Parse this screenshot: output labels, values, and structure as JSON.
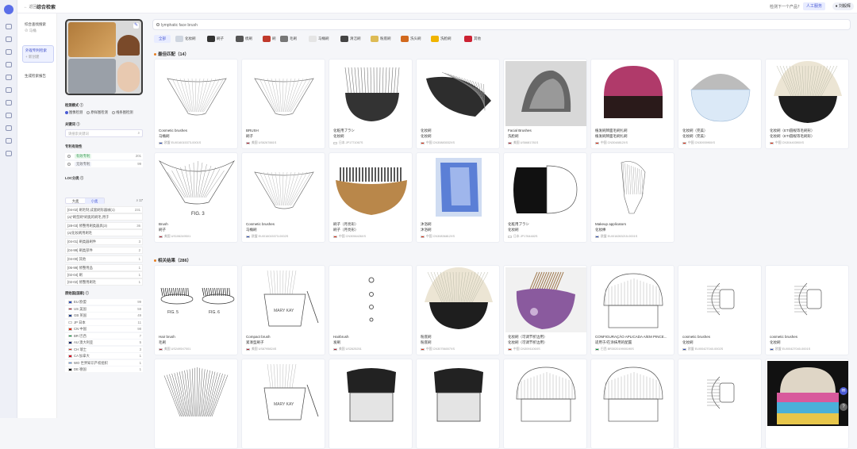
{
  "topbar": {
    "back": "← 返回",
    "title": "综合检索",
    "feedback": "检测下一个产品？",
    "human_btn": "人工服务",
    "user": "● 刘毅辉"
  },
  "sidebar": {
    "items": [
      {
        "label": "综合查找搜索",
        "sub": "⊘ 马桶"
      },
      {
        "label": "外观专利检索",
        "sub": "+ 新创建"
      },
      {
        "label": "生成检索报告",
        "sub": ""
      }
    ]
  },
  "filters": {
    "mode_label": "检测模式 ⓘ",
    "modes": [
      "图像检测",
      "原样图检测",
      "线条图检测"
    ],
    "keyword_label": "关键词 ⓘ",
    "keyword_placeholder": "请搜索关键词",
    "validity_label": "专利有效性",
    "validity": [
      {
        "label": "有效专利",
        "count": "201"
      },
      {
        "label": "无效专利",
        "count": "99"
      }
    ],
    "ldc_label": "LOC分类 ⓘ",
    "ldc_toggle": [
      "大类",
      "小类"
    ],
    "ldc_count": "17",
    "ldc_items": [
      {
        "label": "[04-02] 刷毛制,成套刷形器械(1)",
        "count": "231"
      },
      {
        "label": "(a)\"刷型刷\"刷类的刷毛,用于",
        "count": ""
      },
      {
        "label": "[28-03] 修整用刷类器具(3)",
        "count": "36"
      },
      {
        "label": "(a)化妆刷用刷毛",
        "count": ""
      },
      {
        "label": "[04-01] 刷类器刷件",
        "count": "3"
      },
      {
        "label": "[04-99] 刷类部件",
        "count": "2"
      },
      {
        "label": "[04-00] 其他",
        "count": "1"
      },
      {
        "label": "[06-99] 修整用品",
        "count": "1"
      },
      {
        "label": "[02-04] 刷",
        "count": "1"
      },
      {
        "label": "[02-02] 修整用刷毛",
        "count": "1"
      }
    ],
    "country_label": "原始国(国家) ⓘ",
    "countries": [
      {
        "label": "EU 欧盟",
        "count": "99",
        "color": "#2a4bb8"
      },
      {
        "label": "US 美国",
        "count": "59",
        "color": "#b22234"
      },
      {
        "label": "GB 英国",
        "count": "49",
        "color": "#1f3f8c"
      },
      {
        "label": "JP 日本",
        "count": "11",
        "color": "#ffffff"
      },
      {
        "label": "CN 中国",
        "count": "98",
        "color": "#de2910"
      },
      {
        "label": "BR 巴西",
        "count": "7",
        "color": "#009c3b"
      },
      {
        "label": "AU 澳大利亚",
        "count": "5",
        "color": "#012169"
      },
      {
        "label": "CH 瑞士",
        "count": "3",
        "color": "#d52b1e"
      },
      {
        "label": "CA 加拿大",
        "count": "1",
        "color": "#d80621"
      },
      {
        "label": "WO 世界知识产权组织",
        "count": "1",
        "color": "#5b92e5"
      },
      {
        "label": "DE 德国",
        "count": "1",
        "color": "#000000"
      }
    ]
  },
  "search": {
    "query": "lymphatic face brush"
  },
  "chips": [
    {
      "label": "全部",
      "color": ""
    },
    {
      "label": "化妆刷",
      "color": "#cfd6e0"
    },
    {
      "label": "刷子",
      "color": "#333333"
    },
    {
      "label": "梳刷",
      "color": "#555555"
    },
    {
      "label": "刷",
      "color": "#c0392b"
    },
    {
      "label": "毛刷",
      "color": "#777777"
    },
    {
      "label": "马桶刷",
      "color": "#e5e5e5"
    },
    {
      "label": "清洁刷",
      "color": "#444444"
    },
    {
      "label": "粉底刷",
      "color": "#ddbb55"
    },
    {
      "label": "洗头刷",
      "color": "#d2691e"
    },
    {
      "label": "洗脸刷",
      "color": "#f0b400"
    },
    {
      "label": "其他",
      "color": "#cc2233"
    }
  ],
  "section1": {
    "title": "最佳匹配（14）"
  },
  "section2": {
    "title": "相关结果（286）"
  },
  "cards1": [
    {
      "t1": "Cosmetic brushes",
      "t2": "马桶刷",
      "t3": "欧盟  EUI016015373-0001S",
      "flag": "#2a4bb8",
      "img": "fan"
    },
    {
      "t1": "BRUSH",
      "t2": "刷子",
      "t3": "美国  US6267881S",
      "flag": "#b22234",
      "img": "fan2"
    },
    {
      "t1": "化粧用ブラシ",
      "t2": "化妆刷",
      "t3": "日本  JP1771067S",
      "flag": "#ffffff",
      "img": "dark"
    },
    {
      "t1": "化妆刷",
      "t2": "化妆刷",
      "t3": "中国  CN30883032XS",
      "flag": "#de2910",
      "img": "dark2"
    },
    {
      "t1": "Facial Brushes",
      "t2": "洗脸刷",
      "t3": "美国  US6681781S",
      "flag": "#b22234",
      "img": "grey"
    },
    {
      "t1": "植发刷牌面毛刷扎刷",
      "t2": "植发刷牌面毛刷扎刷",
      "t3": "中国  CN3048812XS",
      "flag": "#de2910",
      "img": "pink"
    },
    {
      "t1": "化妆刷（完美）",
      "t2": "化妆刷（完美）",
      "t3": "中国  CN3093990XS",
      "flag": "#de2910",
      "img": "blue"
    },
    {
      "t1": "化妆刷（ETI圆规等毛刷形）",
      "t2": "化妆刷（ETI圆规等毛刷形）",
      "t3": "中国  CN30440390XS",
      "flag": "#de2910",
      "img": "kabuki"
    },
    {
      "t1": "Brush",
      "t2": "刷子",
      "t3": "美国  US1062495X1",
      "flag": "#b22234",
      "img": "fig3"
    },
    {
      "t1": "Cosmetic brushes",
      "t2": "马桶刷",
      "t3": "欧盟  EUI016015373-0002S",
      "flag": "#2a4bb8",
      "img": "fan2"
    },
    {
      "t1": "刷子（月亮形）",
      "t2": "刷子（月亮形）",
      "t3": "中国  CN3056426XS",
      "flag": "#de2910",
      "img": "wood"
    },
    {
      "t1": "沐浴刷",
      "t2": "沐浴刷",
      "t3": "中国  CN30836812XS",
      "flag": "#de2910",
      "img": "bluebrush"
    },
    {
      "t1": "化粧用ブラシ",
      "t2": "化妆刷",
      "t3": "日本  JP1764482S",
      "flag": "#ffffff",
      "img": "bw"
    },
    {
      "t1": "Makeup applicators",
      "t2": "化妆棒",
      "t3": "欧盟  EUI016263215-0001S",
      "flag": "#2a4bb8",
      "img": "app"
    }
  ],
  "cards2": [
    {
      "t1": "Hair brush",
      "t2": "毛刷",
      "t3": "美国  US2495X7001",
      "flag": "#b22234",
      "img": "lashes"
    },
    {
      "t1": "Compact brush",
      "t2": "紧凑型刷子",
      "t3": "美国  US8795824S",
      "flag": "#b22234",
      "img": "compact"
    },
    {
      "t1": "Hairbrush",
      "t2": "发刷",
      "t3": "美国  US2625251",
      "flag": "#b22234",
      "img": "small"
    },
    {
      "t1": "粉底刷",
      "t2": "粉底刷",
      "t3": "中国  CN30756007XS",
      "flag": "#de2910",
      "img": "kabuki2"
    },
    {
      "t1": "化妆刷（可调节折边用）",
      "t2": "化妆刷（可调节折边用）",
      "t3": "中国  CN3091106XS",
      "flag": "#de2910",
      "img": "purple"
    },
    {
      "t1": "CONFIGURAÇÃO APLICADA A/EM PINCE...",
      "t2": "适用于/在涂抹用的配置",
      "t3": "巴西  BR302019900190S",
      "flag": "#009c3b",
      "img": "line"
    },
    {
      "t1": "cosmetic brushes",
      "t2": "化妆刷",
      "t3": "欧盟  EUI00427040-0002S",
      "flag": "#2a4bb8",
      "img": "side"
    },
    {
      "t1": "cosmetic brushes",
      "t2": "化妆刷",
      "t3": "欧盟  EUI00427040-0001S",
      "flag": "#2a4bb8",
      "img": "side"
    }
  ],
  "cards3": [
    {
      "img": "wave"
    },
    {
      "img": "compact"
    },
    {
      "img": "flat"
    },
    {
      "img": "flat"
    },
    {
      "img": "line"
    },
    {
      "img": "line2"
    },
    {
      "img": "side"
    },
    {
      "img": "rainbow"
    }
  ]
}
